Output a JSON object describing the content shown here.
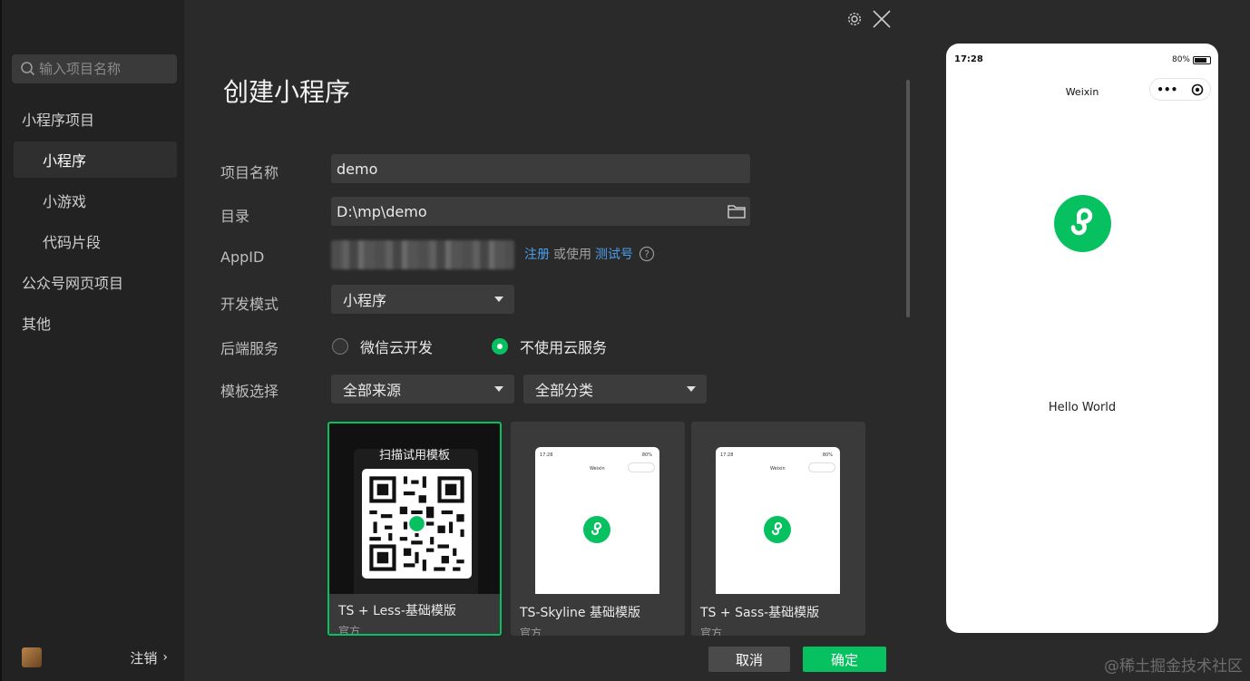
{
  "sidebar": {
    "search_placeholder": "输入项目名称",
    "items": [
      {
        "label": "小程序项目"
      },
      {
        "label": "小程序"
      },
      {
        "label": "小游戏"
      },
      {
        "label": "代码片段"
      },
      {
        "label": "公众号网页项目"
      },
      {
        "label": "其他"
      }
    ],
    "logout_label": "注销",
    "logout_chevron": "›"
  },
  "main": {
    "title": "创建小程序",
    "form": {
      "project_name_label": "项目名称",
      "project_name_value": "demo",
      "dir_label": "目录",
      "dir_value": "D:\\mp\\demo",
      "appid_label": "AppID",
      "register_link": "注册",
      "or_use": "或使用",
      "test_link": "测试号",
      "dev_mode_label": "开发模式",
      "dev_mode_value": "小程序",
      "backend_label": "后端服务",
      "backend_options": [
        {
          "label": "微信云开发",
          "selected": false
        },
        {
          "label": "不使用云服务",
          "selected": true
        }
      ],
      "template_label": "模板选择",
      "template_source": "全部来源",
      "template_category": "全部分类"
    },
    "templates": [
      {
        "name": "TS + Less-基础模版",
        "tag": "官方",
        "qr_title": "扫描试用模板",
        "selected": true
      },
      {
        "name": "TS-Skyline 基础模版",
        "tag": "官方",
        "selected": false
      },
      {
        "name": "TS + Sass-基础模版",
        "tag": "官方",
        "selected": false
      }
    ],
    "mini_preview": {
      "time": "17:28",
      "battery": "80%",
      "title": "Weixin"
    },
    "buttons": {
      "cancel": "取消",
      "ok": "确定"
    }
  },
  "preview": {
    "time": "17:28",
    "battery": "80%",
    "title": "Weixin",
    "capsule_more": "•••",
    "content": "Hello World"
  },
  "watermark": "@稀土掘金技术社区",
  "colors": {
    "accent": "#07c160",
    "link": "#4a9eea",
    "sidebar_bg": "#222222",
    "main_bg": "#2a2a2a"
  }
}
